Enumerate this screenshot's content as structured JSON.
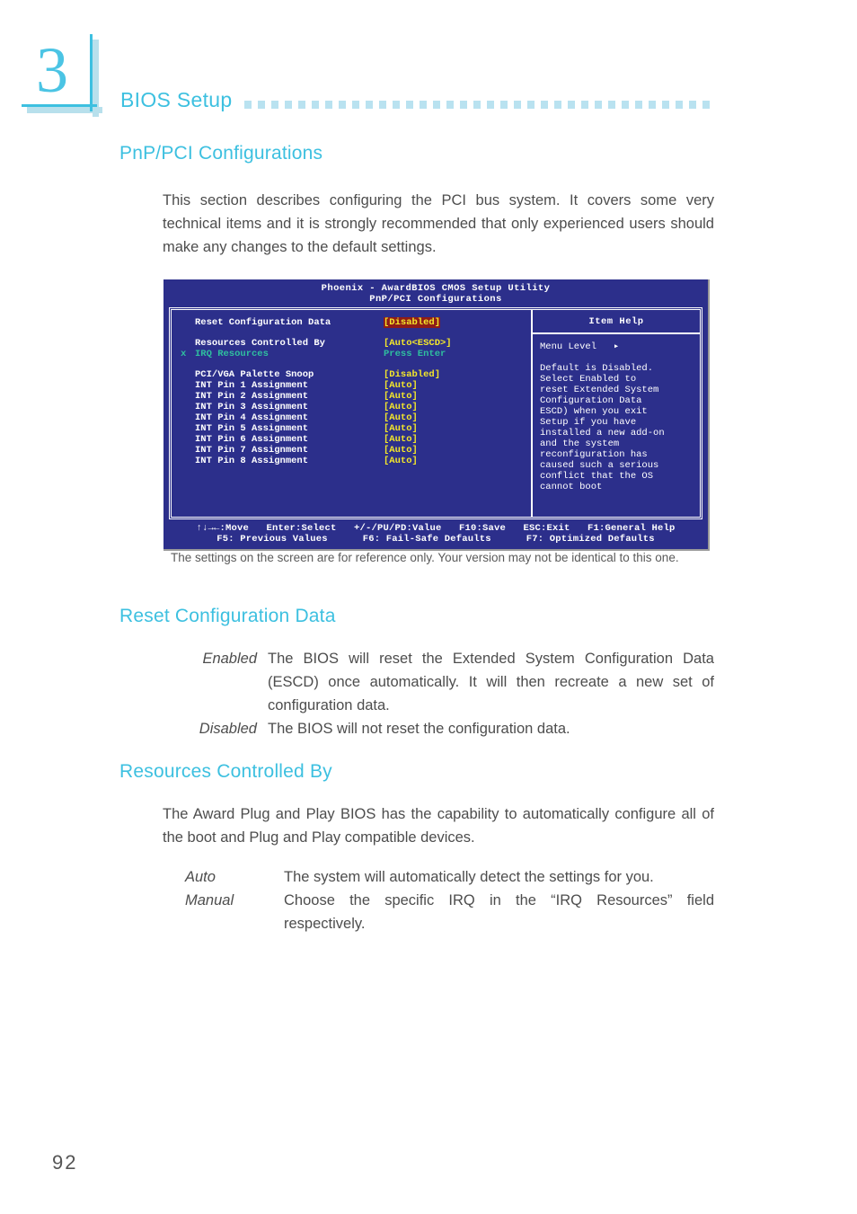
{
  "header": {
    "chapter_number": "3",
    "title": "BIOS Setup"
  },
  "page": {
    "number": "92"
  },
  "sections": {
    "pnp_heading": "PnP/PCI Configurations",
    "intro_paragraph": "This section describes configuring the PCI bus system. It covers some very technical items and it is strongly recommended that only experienced users should make any changes to the default settings.",
    "figure_caption": "The settings on the screen are for reference only. Your version may not be identical to this one.",
    "reset_heading": "Reset Configuration Data",
    "reset_items": [
      {
        "term": "Enabled",
        "desc": "The BIOS will reset the Extended System Configuration Data (ESCD) once automatically. It will then recreate a new set of configuration data."
      },
      {
        "term": "Disabled",
        "desc": "The BIOS will not reset the configuration data."
      }
    ],
    "resources_heading": "Resources Controlled By",
    "resources_paragraph": "The Award Plug and Play BIOS has the capability to automatically configure all of the boot and Plug and Play compatible devices.",
    "resources_items": [
      {
        "term": "Auto",
        "desc": "The system will automatically detect the settings for you."
      },
      {
        "term": "Manual",
        "desc": "Choose the specific IRQ in the “IRQ Resources” field respectively."
      }
    ]
  },
  "bios_screen": {
    "title_line1": "Phoenix - AwardBIOS CMOS Setup Utility",
    "title_line2": "PnP/PCI Configurations",
    "rows": [
      {
        "label": "Reset Configuration Data",
        "value": "[Disabled]",
        "selected": true
      },
      {
        "label": "Resources Controlled By",
        "value": "[Auto<ESCD>]",
        "selected": false
      },
      {
        "mark": "x",
        "label": "IRQ Resources",
        "value": "Press Enter",
        "dim": true
      },
      {
        "label": "PCI/VGA Palette Snoop",
        "value": "[Disabled]",
        "selected": false
      },
      {
        "label": "INT Pin 1 Assignment",
        "value": "[Auto]",
        "selected": false
      },
      {
        "label": "INT Pin 2 Assignment",
        "value": "[Auto]",
        "selected": false
      },
      {
        "label": "INT Pin 3 Assignment",
        "value": "[Auto]",
        "selected": false
      },
      {
        "label": "INT Pin 4 Assignment",
        "value": "[Auto]",
        "selected": false
      },
      {
        "label": "INT Pin 5 Assignment",
        "value": "[Auto]",
        "selected": false
      },
      {
        "label": "INT Pin 6 Assignment",
        "value": "[Auto]",
        "selected": false
      },
      {
        "label": "INT Pin 7 Assignment",
        "value": "[Auto]",
        "selected": false
      },
      {
        "label": "INT Pin 8 Assignment",
        "value": "[Auto]",
        "selected": false
      }
    ],
    "help_title": "Item Help",
    "menu_level": "Menu Level   ▸",
    "help_lines": [
      "Default is Disabled.",
      "Select Enabled to",
      "reset Extended System",
      "Configuration Data",
      "ESCD) when you exit",
      "Setup if you have",
      "installed a new add-on",
      "and the system",
      "reconfiguration has",
      "caused such a serious",
      "conflict that the OS",
      "cannot boot"
    ],
    "footer_line1": "↑↓→←:Move   Enter:Select   +/-/PU/PD:Value   F10:Save   ESC:Exit   F1:General Help",
    "footer_line2": "F5: Previous Values      F6: Fail-Safe Defaults      F7: Optimized Defaults"
  },
  "colors": {
    "accent_cyan": "#3dc0e0",
    "dots_light": "#b9e2f0",
    "bios_bg": "#2c2f8b",
    "bios_value": "#f4e72a",
    "bios_selected_bg": "#8e1c18",
    "bios_dim": "#2fbf9f"
  }
}
